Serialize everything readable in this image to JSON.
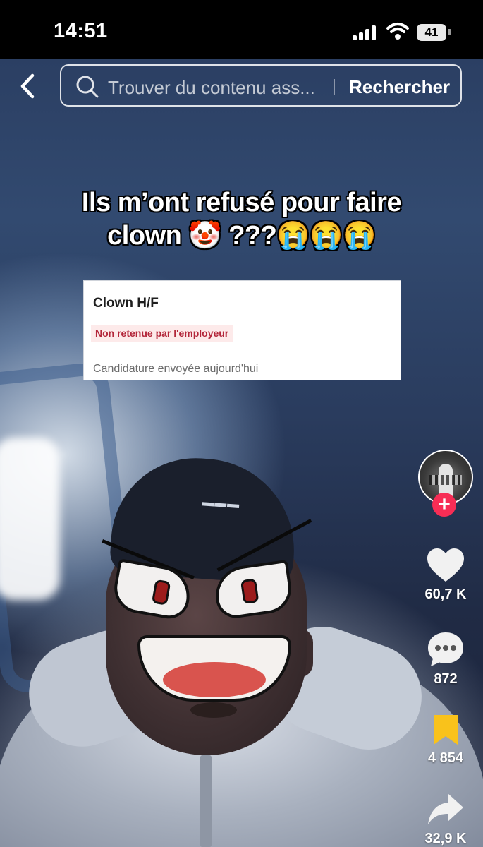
{
  "status_bar": {
    "time": "14:51",
    "battery": "41"
  },
  "search": {
    "placeholder": "Trouver du contenu ass...",
    "button_label": "Rechercher"
  },
  "caption": {
    "line1": "Ils m’ont refusé pour faire",
    "line2": "clown 🤡 ???😭😭😭"
  },
  "job_card": {
    "title": "Clown H/F",
    "status": "Non retenue par l'employeur",
    "sent": "Candidature envoyée aujourd'hui"
  },
  "rail": {
    "likes": "60,7 K",
    "comments": "872",
    "saves": "4 854",
    "shares": "32,9 K"
  },
  "colors": {
    "accent": "#f72d55",
    "save": "#f9c21b",
    "status_text": "#b3263a"
  },
  "icons": [
    "back-chevron-icon",
    "search-icon",
    "plus-icon",
    "heart-icon",
    "comment-icon",
    "bookmark-icon",
    "share-icon"
  ]
}
